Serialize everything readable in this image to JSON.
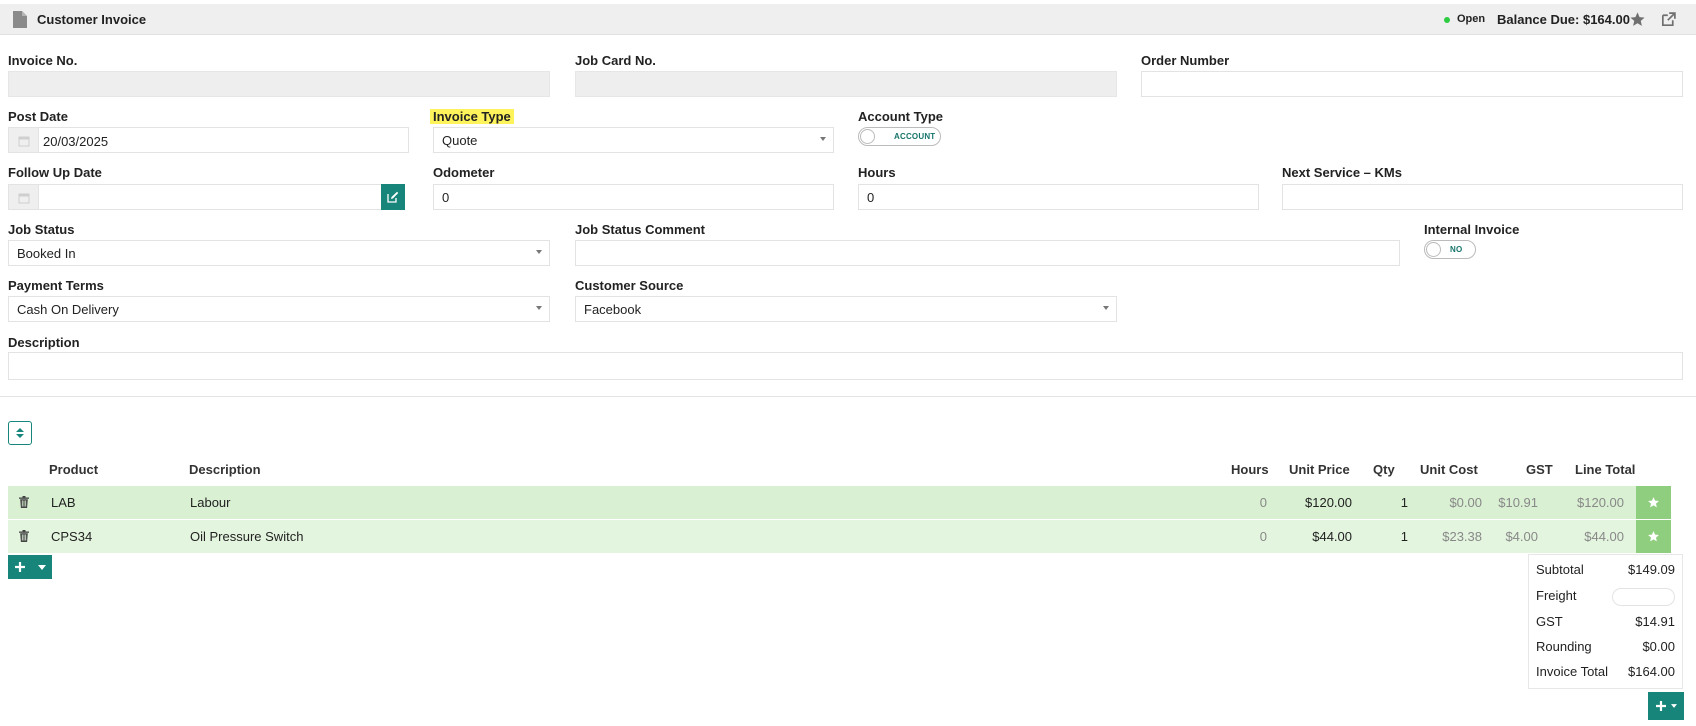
{
  "header": {
    "title": "Customer Invoice",
    "status": "Open",
    "balance_due": "Balance Due: $164.00"
  },
  "form": {
    "invoice_no": {
      "label": "Invoice No.",
      "value": ""
    },
    "job_card_no": {
      "label": "Job Card No.",
      "value": ""
    },
    "order_number": {
      "label": "Order Number",
      "value": ""
    },
    "post_date": {
      "label": "Post Date",
      "value": "20/03/2025"
    },
    "invoice_type": {
      "label": "Invoice Type",
      "value": "Quote"
    },
    "account_type": {
      "label": "Account Type",
      "toggle": "ACCOUNT"
    },
    "follow_up_date": {
      "label": "Follow Up Date",
      "value": ""
    },
    "odometer": {
      "label": "Odometer",
      "value": "0"
    },
    "hours": {
      "label": "Hours",
      "value": "0"
    },
    "next_service": {
      "label": "Next Service – KMs",
      "value": ""
    },
    "job_status": {
      "label": "Job Status",
      "value": "Booked In"
    },
    "job_status_comment": {
      "label": "Job Status Comment",
      "value": ""
    },
    "internal_invoice": {
      "label": "Internal Invoice",
      "toggle": "NO"
    },
    "payment_terms": {
      "label": "Payment Terms",
      "value": "Cash On Delivery"
    },
    "customer_source": {
      "label": "Customer Source",
      "value": "Facebook"
    },
    "description": {
      "label": "Description",
      "value": ""
    }
  },
  "table": {
    "columns": [
      "Product",
      "Description",
      "Hours",
      "Unit Price",
      "Qty",
      "Unit Cost",
      "GST",
      "Line Total"
    ],
    "rows": [
      {
        "product": "LAB",
        "description": "Labour",
        "hours": "0",
        "unit_price": "$120.00",
        "qty": "1",
        "unit_cost": "$0.00",
        "gst": "$10.91",
        "line_total": "$120.00"
      },
      {
        "product": "CPS34",
        "description": "Oil Pressure Switch",
        "hours": "0",
        "unit_price": "$44.00",
        "qty": "1",
        "unit_cost": "$23.38",
        "gst": "$4.00",
        "line_total": "$44.00"
      }
    ]
  },
  "totals": {
    "subtotal": {
      "label": "Subtotal",
      "value": "$149.09"
    },
    "freight": {
      "label": "Freight",
      "value": ""
    },
    "gst": {
      "label": "GST",
      "value": "$14.91"
    },
    "rounding": {
      "label": "Rounding",
      "value": "$0.00"
    },
    "invoice_total": {
      "label": "Invoice Total",
      "value": "$164.00"
    }
  },
  "colors": {
    "accent": "#17857a",
    "row_green": "#d9f0d3",
    "status_dot": "#2ecc40",
    "highlight": "#fff35c"
  },
  "icons": [
    "document-icon",
    "star-icon",
    "external-link-icon",
    "calendar-icon",
    "edit-icon",
    "sort-icon",
    "trash-icon",
    "plus-icon",
    "chevron-down-icon"
  ]
}
